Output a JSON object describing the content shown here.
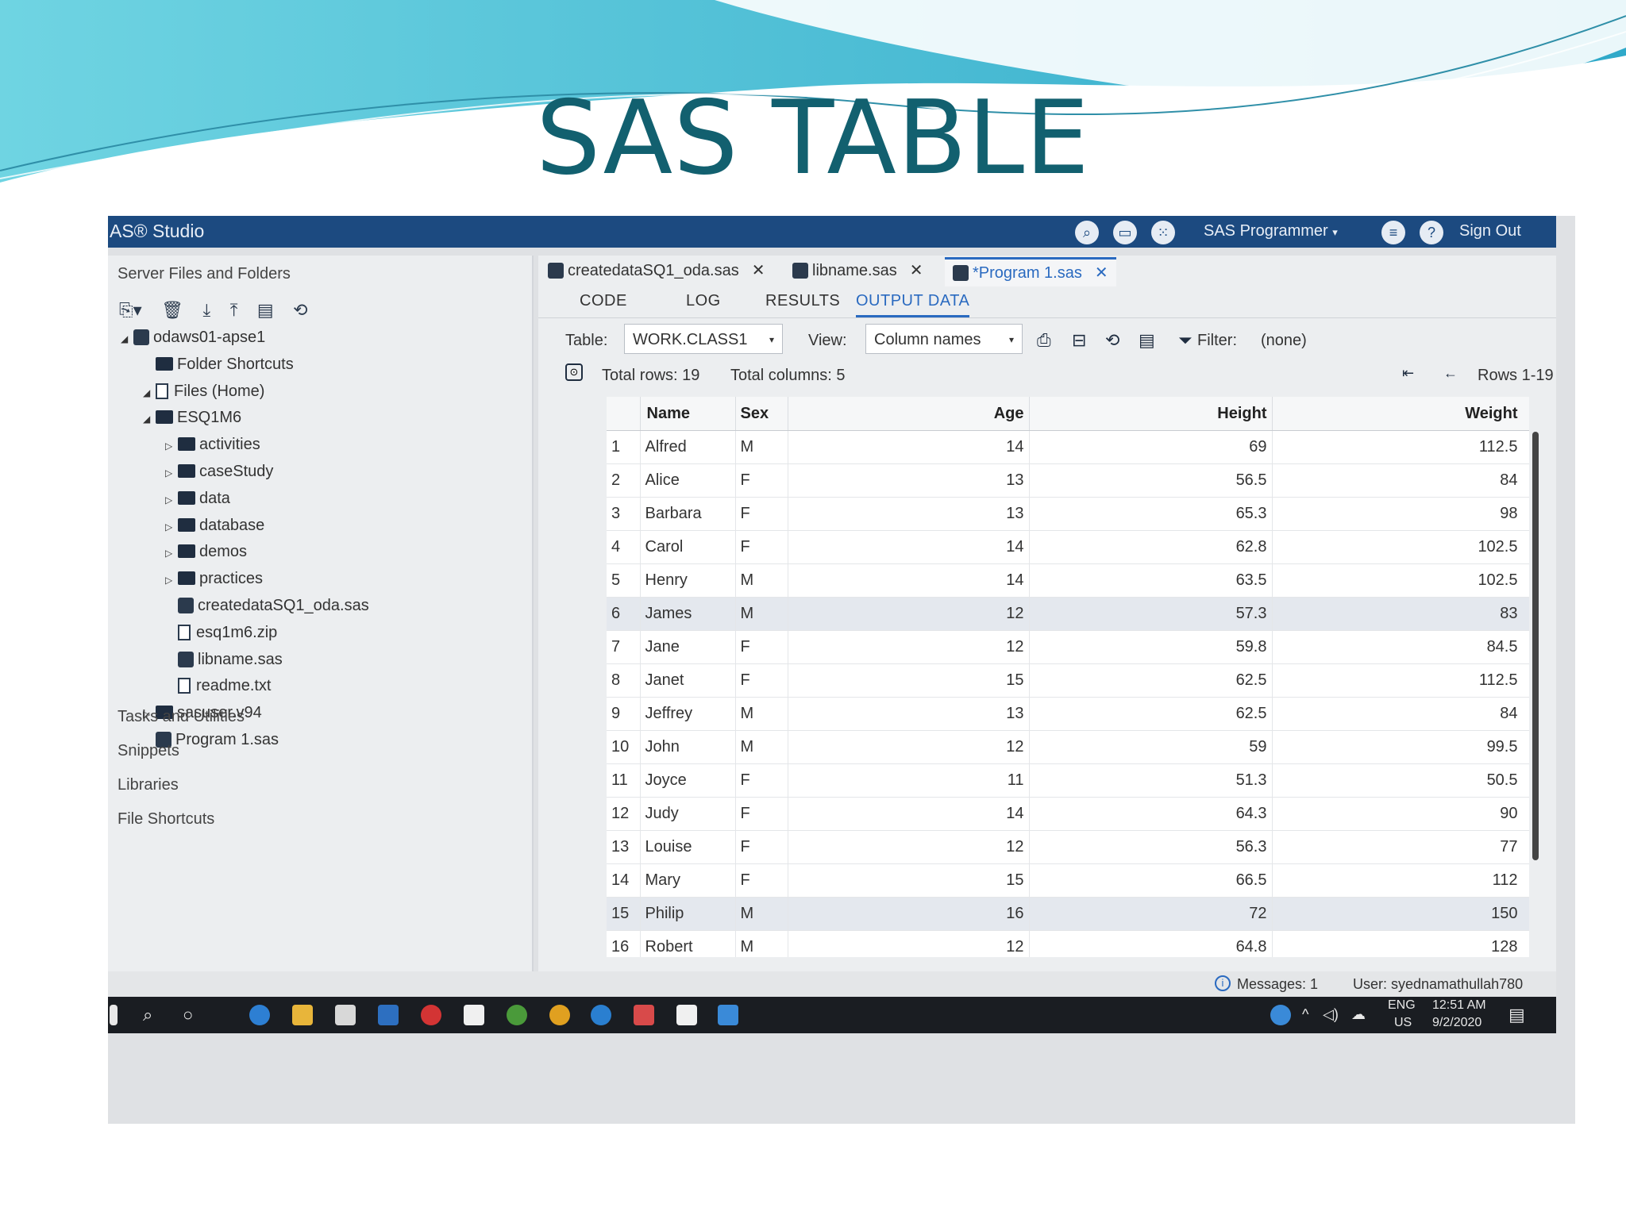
{
  "slide": {
    "title": "SAS TABLE"
  },
  "app": {
    "brand": "AS® Studio",
    "role": "SAS Programmer",
    "role_caret": "▾",
    "sign_out": "Sign Out"
  },
  "left_pane": {
    "header": "Server Files and Folders",
    "tools": [
      "⎘▾",
      "🗑",
      "⤓",
      "⤒",
      "▤",
      "⟲"
    ],
    "tree": [
      {
        "label": "odaws01-apse1",
        "kind": "server",
        "arrow": "◢",
        "depth": 0
      },
      {
        "label": "Folder Shortcuts",
        "kind": "shortcut",
        "arrow": "",
        "depth": 1
      },
      {
        "label": "Files (Home)",
        "kind": "home",
        "arrow": "◢",
        "depth": 1
      },
      {
        "label": "ESQ1M6",
        "kind": "folder",
        "arrow": "◢",
        "depth": 2
      },
      {
        "label": "activities",
        "kind": "folder",
        "arrow": "▷",
        "depth": 3
      },
      {
        "label": "caseStudy",
        "kind": "folder",
        "arrow": "▷",
        "depth": 3
      },
      {
        "label": "data",
        "kind": "folder",
        "arrow": "▷",
        "depth": 3
      },
      {
        "label": "database",
        "kind": "folder",
        "arrow": "▷",
        "depth": 3
      },
      {
        "label": "demos",
        "kind": "folder",
        "arrow": "▷",
        "depth": 3
      },
      {
        "label": "practices",
        "kind": "folder",
        "arrow": "▷",
        "depth": 3
      },
      {
        "label": "createdataSQ1_oda.sas",
        "kind": "sas",
        "arrow": "",
        "depth": 3
      },
      {
        "label": "esq1m6.zip",
        "kind": "file",
        "arrow": "",
        "depth": 3
      },
      {
        "label": "libname.sas",
        "kind": "sas",
        "arrow": "",
        "depth": 3
      },
      {
        "label": "readme.txt",
        "kind": "file",
        "arrow": "",
        "depth": 3
      },
      {
        "label": "sasuser.v94",
        "kind": "folder",
        "arrow": "▷",
        "depth": 2
      },
      {
        "label": "Program 1.sas",
        "kind": "sas",
        "arrow": "",
        "depth": 2
      }
    ],
    "sections": [
      "Tasks and Utilities",
      "Snippets",
      "Libraries",
      "File Shortcuts"
    ]
  },
  "file_tabs": [
    {
      "label": "createdataSQ1_oda.sas",
      "close": "✕"
    },
    {
      "label": "libname.sas",
      "close": "✕"
    },
    {
      "label": "*Program 1.sas",
      "close": "✕"
    }
  ],
  "sub_tabs": [
    "CODE",
    "LOG",
    "RESULTS",
    "OUTPUT DATA"
  ],
  "toolbar": {
    "table_label": "Table:",
    "table_value": "WORK.CLASS1",
    "view_label": "View:",
    "view_value": "Column names",
    "filter_label": "Filter:",
    "filter_value": "(none)",
    "caret": "▾"
  },
  "info": {
    "total_rows": "Total rows: 19",
    "total_columns": "Total columns: 5",
    "rows_range": "Rows 1-19"
  },
  "table": {
    "columns": [
      "",
      "Name",
      "Sex",
      "Age",
      "Height",
      "Weight"
    ],
    "rows": [
      [
        "1",
        "Alfred",
        "M",
        "14",
        "69",
        "112.5"
      ],
      [
        "2",
        "Alice",
        "F",
        "13",
        "56.5",
        "84"
      ],
      [
        "3",
        "Barbara",
        "F",
        "13",
        "65.3",
        "98"
      ],
      [
        "4",
        "Carol",
        "F",
        "14",
        "62.8",
        "102.5"
      ],
      [
        "5",
        "Henry",
        "M",
        "14",
        "63.5",
        "102.5"
      ],
      [
        "6",
        "James",
        "M",
        "12",
        "57.3",
        "83"
      ],
      [
        "7",
        "Jane",
        "F",
        "12",
        "59.8",
        "84.5"
      ],
      [
        "8",
        "Janet",
        "F",
        "15",
        "62.5",
        "112.5"
      ],
      [
        "9",
        "Jeffrey",
        "M",
        "13",
        "62.5",
        "84"
      ],
      [
        "10",
        "John",
        "M",
        "12",
        "59",
        "99.5"
      ],
      [
        "11",
        "Joyce",
        "F",
        "11",
        "51.3",
        "50.5"
      ],
      [
        "12",
        "Judy",
        "F",
        "14",
        "64.3",
        "90"
      ],
      [
        "13",
        "Louise",
        "F",
        "12",
        "56.3",
        "77"
      ],
      [
        "14",
        "Mary",
        "F",
        "15",
        "66.5",
        "112"
      ],
      [
        "15",
        "Philip",
        "M",
        "16",
        "72",
        "150"
      ],
      [
        "16",
        "Robert",
        "M",
        "12",
        "64.8",
        "128"
      ]
    ],
    "highlighted_rows": [
      "6",
      "15"
    ]
  },
  "status": {
    "messages": "Messages: 1",
    "user": "User: syednamathullah780"
  },
  "taskbar": {
    "lang": "ENG",
    "region": "US",
    "time": "12:51 AM",
    "date": "9/2/2020"
  },
  "colors": {
    "title": "#12606f",
    "topbar": "#1c4a80",
    "accent": "#2a6ac0"
  }
}
